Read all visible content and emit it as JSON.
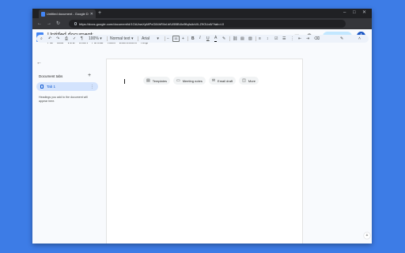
{
  "browser": {
    "tab_title": "Untitled document - Google Do",
    "tab_close": "✕",
    "new_tab": "+",
    "url": "https://docs.google.com/document/d/1OAJwsXpMPxG84hRlInl.bfUl5BB4lo9flqfsArkXLZ9OUx8/?tab=t.0",
    "minimize": "–",
    "maximize": "□",
    "close": "✕",
    "back": "←",
    "forward": "→",
    "reload": "↻"
  },
  "docs": {
    "title": "Untitled document",
    "star": "☆",
    "menu": [
      "File",
      "Edit",
      "View",
      "Insert",
      "Format",
      "Tools",
      "Extensions",
      "Help"
    ],
    "share_label": "Share",
    "avatar_letter": "A"
  },
  "toolbar": {
    "search": "⌕",
    "undo": "↶",
    "redo": "↷",
    "print": "⎙",
    "spellcheck": "✓",
    "paint_format": "¶",
    "zoom": "100%",
    "zoom_caret": "▾",
    "style": "Normal text",
    "style_caret": "▾",
    "font": "Arial",
    "font_caret": "▾",
    "font_decrease": "−",
    "font_size": "11",
    "font_increase": "+",
    "bold": "B",
    "italic": "I",
    "underline": "U",
    "text_color": "A",
    "highlight": "✎",
    "link": "⛓",
    "comment": "▤",
    "image": "▨",
    "align": "≡",
    "line_spacing": "↕",
    "checklist": "☑",
    "bullets": "☰",
    "numbered": "⋮",
    "indent_less": "⇤",
    "indent_more": "⇥",
    "clear_format": "⌫",
    "editing_mode": "✎",
    "collapse": "˄"
  },
  "sidebar": {
    "back": "←",
    "title": "Document tabs",
    "add": "+",
    "tab_label": "Tab 1",
    "tab_menu": "⋮",
    "hint": "Headings you add to the document will appear here."
  },
  "page": {
    "chips": [
      {
        "icon": "▤",
        "label": "Templates"
      },
      {
        "icon": "▭",
        "label": "Meeting notes"
      },
      {
        "icon": "✉",
        "label": "Email draft"
      },
      {
        "icon": "◫",
        "label": "More"
      }
    ]
  },
  "explore_icon": "+"
}
